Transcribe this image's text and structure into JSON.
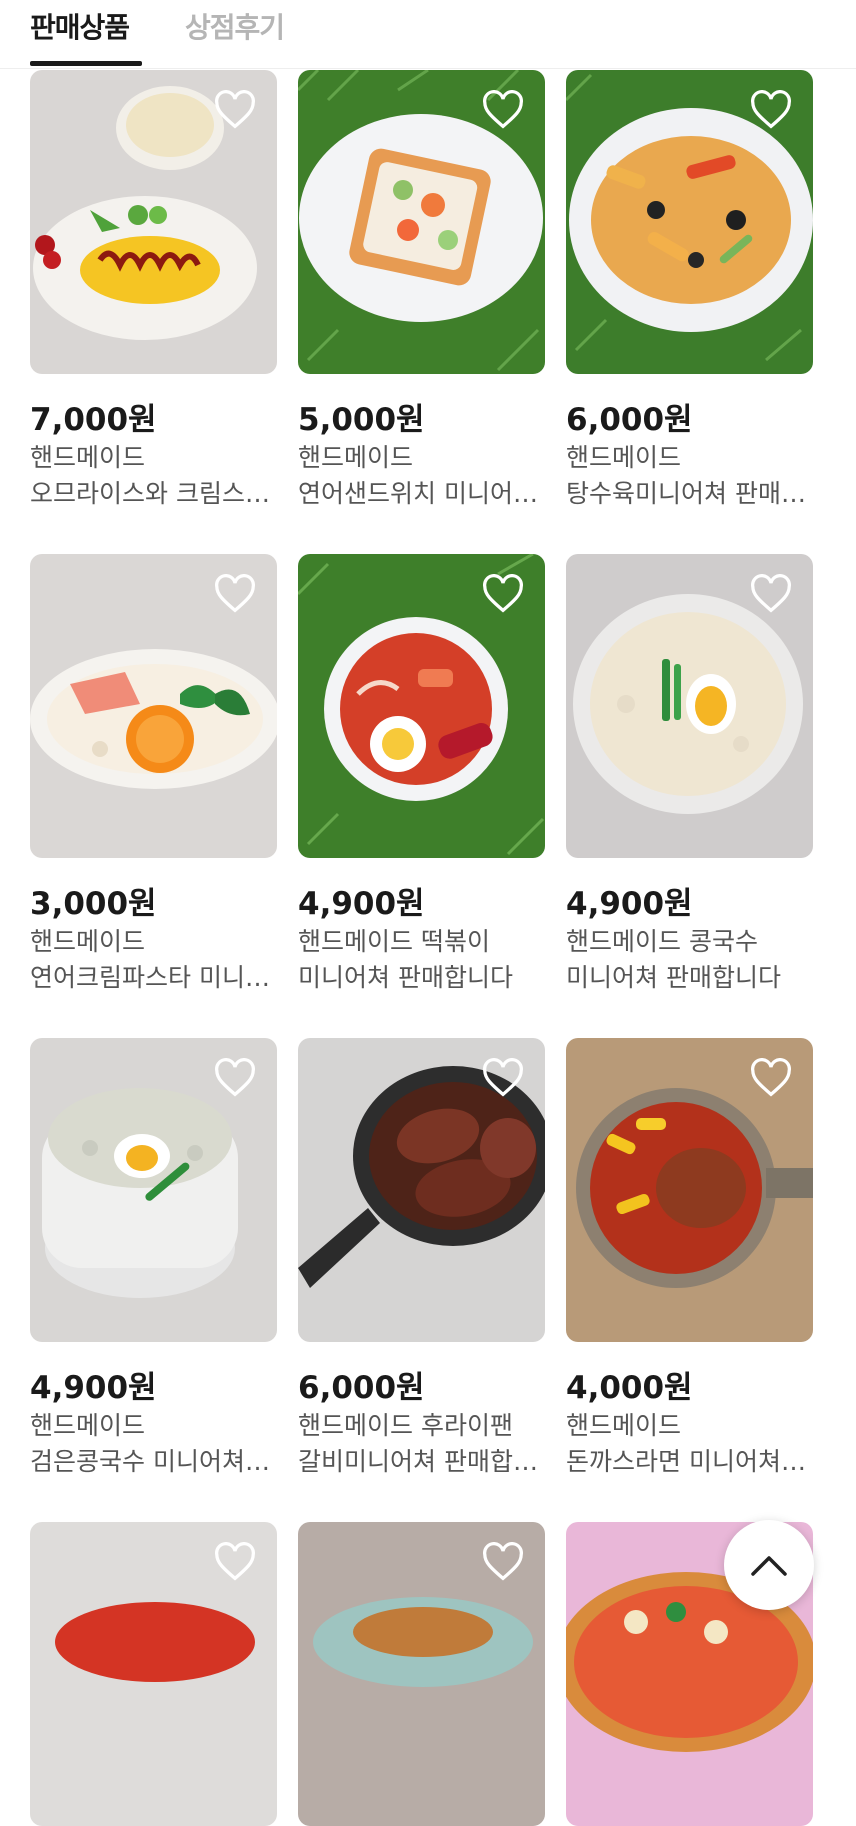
{
  "tabs": {
    "products": "판매상품",
    "reviews": "상점후기"
  },
  "products": [
    {
      "price": "7,000원",
      "line1": "핸드메이드",
      "line2": "오므라이스와 크림스프 미니어쳐",
      "image": "omurice-plate"
    },
    {
      "price": "5,000원",
      "line1": "핸드메이드",
      "line2": "연어샌드위치 미니어쳐 판매합니다",
      "image": "salmon-sandwich"
    },
    {
      "price": "6,000원",
      "line1": "핸드메이드",
      "line2": "탕수육미니어쳐 판매합니다",
      "image": "sweet-sour-pork"
    },
    {
      "price": "3,000원",
      "line1": "핸드메이드",
      "line2": "연어크림파스타 미니어쳐 판매합니다",
      "image": "salmon-cream-pasta"
    },
    {
      "price": "4,900원",
      "line1": "핸드메이드 떡볶이",
      "line2": "미니어쳐 판매합니다",
      "image": "tteokbokki"
    },
    {
      "price": "4,900원",
      "line1": "핸드메이드 콩국수",
      "line2": "미니어쳐 판매합니다",
      "image": "kongguksu"
    },
    {
      "price": "4,900원",
      "line1": "핸드메이드",
      "line2": "검은콩국수 미니어쳐 판매합니다",
      "image": "black-bean-noodles"
    },
    {
      "price": "6,000원",
      "line1": "핸드메이드 후라이팬",
      "line2": "갈비미니어쳐 판매합니다",
      "image": "galbi-pan"
    },
    {
      "price": "4,000원",
      "line1": "핸드메이드",
      "line2": "돈까스라면 미니어쳐 판매합니다",
      "image": "donkatsu-ramen"
    },
    {
      "price": "",
      "line1": "",
      "line2": "",
      "image": "partial-1"
    },
    {
      "price": "",
      "line1": "",
      "line2": "",
      "image": "partial-2"
    },
    {
      "price": "",
      "line1": "",
      "line2": "",
      "image": "pizza"
    }
  ],
  "icons": {
    "like": "heart-outline-icon",
    "scroll_top": "chevron-up-icon"
  },
  "colors": {
    "text": "#1a1a1a",
    "muted": "#555555",
    "tab_inactive": "#b5b5b5"
  }
}
